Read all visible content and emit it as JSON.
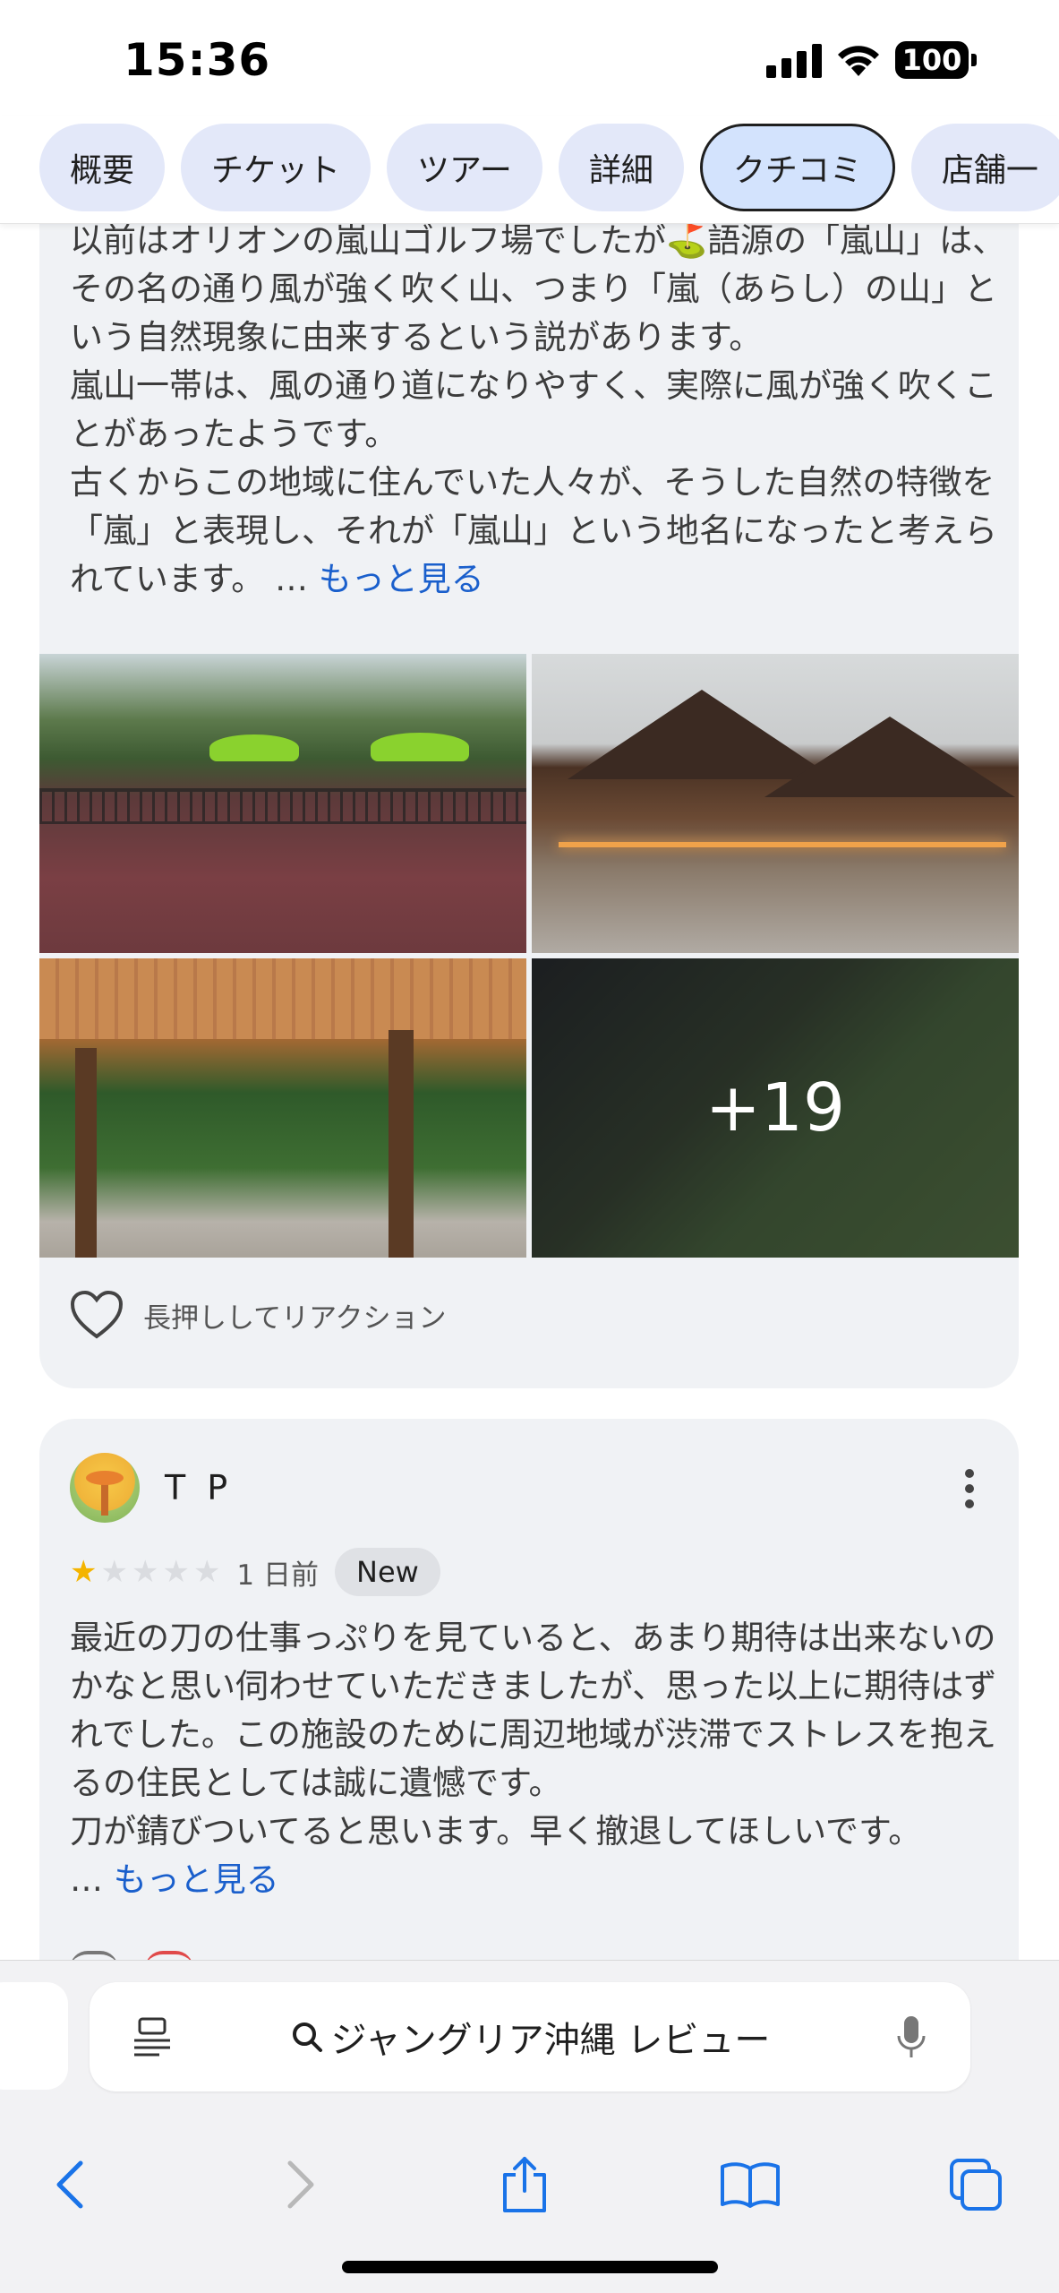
{
  "status_bar": {
    "time": "15:36",
    "battery": "100",
    "icons": [
      "cellular-signal-icon",
      "wifi-icon",
      "battery-icon"
    ]
  },
  "tabs": [
    {
      "label": "概要",
      "active": false
    },
    {
      "label": "チケット",
      "active": false
    },
    {
      "label": "ツアー",
      "active": false
    },
    {
      "label": "詳細",
      "active": false
    },
    {
      "label": "クチコミ",
      "active": true
    },
    {
      "label": "店舗一",
      "active": false
    }
  ],
  "review_1": {
    "text_line_1": "以前はオリオンの嵐山ゴルフ場でしたが⛳語源の「嵐山」は、その名の通り風が強く吹く山、つまり「嵐（あらし）の山」という自然現象に由来するという説があります。",
    "text_line_2": "嵐山一帯は、風の通り道になりやすく、実際に風が強く吹くことがあったようです。",
    "text_line_3": "古くからこの地域に住んでいた人々が、そうした自然の特徴を「嵐」と表現し、それが「嵐山」という地名になったと考えられています。",
    "ellipsis": "…",
    "more_link": "もっと見る",
    "photos_more_count": "+19",
    "reaction_label": "長押ししてリアクション"
  },
  "review_2": {
    "reviewer_name": "T P",
    "rating": 1,
    "rating_max": 5,
    "date": "1 日前",
    "badge": "New",
    "text_line_1": "最近の刀の仕事っぷりを見ていると、あまり期待は出来ないのかなと思い伺わせていただきましたが、思った以上に期待はずれでした。この施設のために周辺地域が渋滞でストレスを抱えるの住民としては誠に遺憾です。",
    "text_line_2": "刀が錆びついてると思います。早く撤退してほしいです。",
    "ellipsis": "…",
    "more_link": "もっと見る"
  },
  "browser": {
    "search_query": "ジャングリア沖縄 レビュー",
    "nav_icons": [
      "back-icon",
      "forward-icon",
      "share-icon",
      "bookmarks-icon",
      "tabs-icon"
    ]
  },
  "colors": {
    "link": "#1a5fcc",
    "tab_bg": "#e3e8f9",
    "tab_active_bg": "#d3e3fd",
    "card_bg": "#f0f2f5",
    "star_on": "#f4b400",
    "nav_icon": "#1a73e8"
  }
}
